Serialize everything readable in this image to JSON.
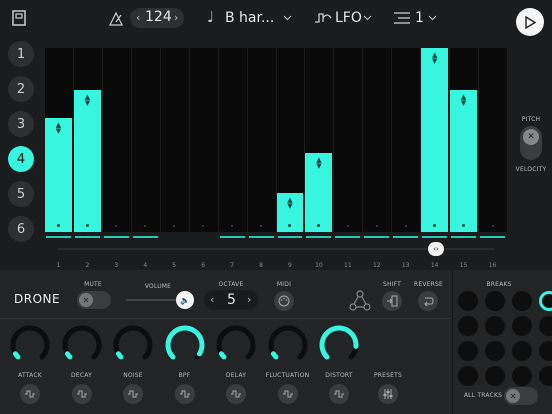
{
  "topbar": {
    "tempo": "124",
    "key": "B har...",
    "mode": "LFO",
    "pattern": "1"
  },
  "tracks": [
    "1",
    "2",
    "3",
    "4",
    "5",
    "6"
  ],
  "active_track_index": 3,
  "steps": {
    "numbers": [
      "1",
      "2",
      "3",
      "4",
      "5",
      "6",
      "7",
      "8",
      "9",
      "10",
      "11",
      "12",
      "13",
      "14",
      "15",
      "16"
    ],
    "values": [
      0.62,
      0.77,
      0,
      0,
      0,
      0,
      0,
      0,
      0.21,
      0.43,
      0,
      0,
      0,
      1.0,
      0.77,
      0
    ]
  },
  "side": {
    "pitch_label": "PITCH",
    "velocity_label": "VELOCITY"
  },
  "controls": {
    "track_name": "DRONE",
    "mute_label": "MUTE",
    "volume_label": "VOLUME",
    "octave_label": "OCTAVE",
    "octave_value": "5",
    "midi_label": "MIDI",
    "shift_label": "SHIFT",
    "reverse_label": "REVERSE",
    "breaks_label": "BREAKS",
    "all_tracks_label": "ALL TRACKS",
    "presets_label": "PRESETS"
  },
  "knobs": [
    {
      "label": "ATTACK",
      "level": 0.9,
      "active": false
    },
    {
      "label": "DECAY",
      "level": 0.75,
      "active": false
    },
    {
      "label": "NOISE",
      "level": 0.45,
      "active": false
    },
    {
      "label": "BPF",
      "level": 0.95,
      "active": true
    },
    {
      "label": "DELAY",
      "level": 0.5,
      "active": false
    },
    {
      "label": "FLUCTUATION",
      "level": 0.7,
      "active": false
    },
    {
      "label": "DISTORT",
      "level": 0.85,
      "active": true
    }
  ],
  "colors": {
    "accent": "#38f5df",
    "panel": "#232425",
    "background": "#1b1c1d"
  }
}
